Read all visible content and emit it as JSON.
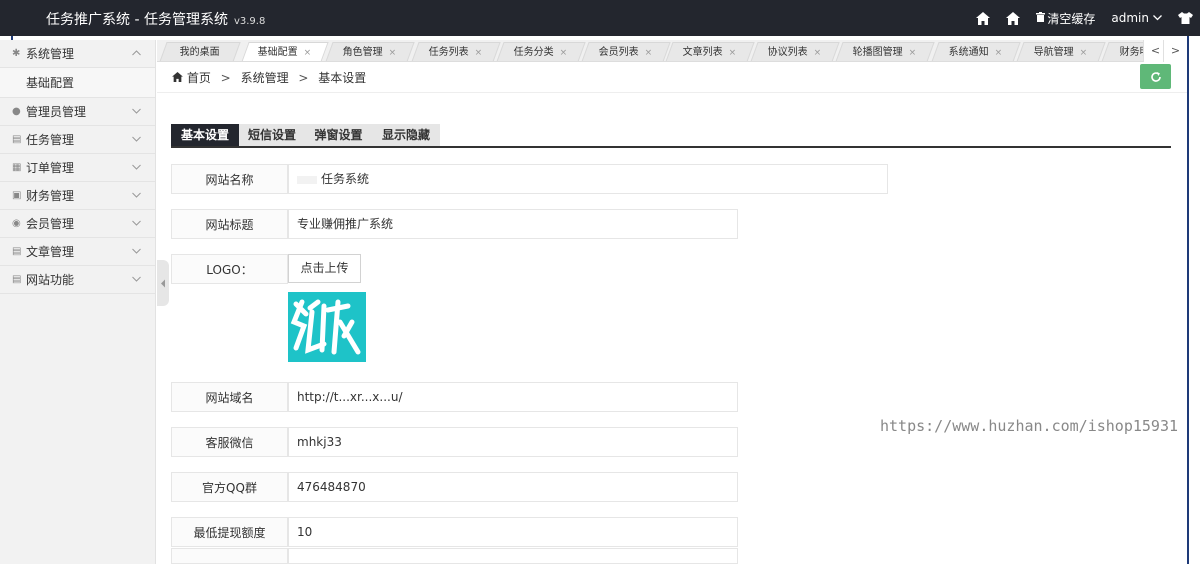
{
  "header": {
    "title": "任务推广系统 - 任务管理系统",
    "version": "v3.9.8",
    "home_icon_1": "home-icon",
    "home_icon_2": "home-icon",
    "clear_cache": "清空缓存",
    "user": "admin",
    "theme_icon": "shirt-icon"
  },
  "sidebar": {
    "items": [
      {
        "label": "系统管理",
        "icon": "gear-icon",
        "expanded": true
      },
      {
        "label": "管理员管理",
        "icon": "user-icon"
      },
      {
        "label": "任务管理",
        "icon": "list-icon"
      },
      {
        "label": "订单管理",
        "icon": "order-icon"
      },
      {
        "label": "财务管理",
        "icon": "finance-icon"
      },
      {
        "label": "会员管理",
        "icon": "member-icon"
      },
      {
        "label": "文章管理",
        "icon": "article-icon"
      },
      {
        "label": "网站功能",
        "icon": "site-icon"
      }
    ],
    "sub_item": "基础配置"
  },
  "tabs": [
    {
      "label": "我的桌面",
      "closable": false
    },
    {
      "label": "基础配置",
      "closable": true,
      "active": true
    },
    {
      "label": "角色管理",
      "closable": true
    },
    {
      "label": "任务列表",
      "closable": true
    },
    {
      "label": "任务分类",
      "closable": true
    },
    {
      "label": "会员列表",
      "closable": true
    },
    {
      "label": "文章列表",
      "closable": true
    },
    {
      "label": "协议列表",
      "closable": true
    },
    {
      "label": "轮播图管理",
      "closable": true
    },
    {
      "label": "系统通知",
      "closable": true
    },
    {
      "label": "导航管理",
      "closable": true
    },
    {
      "label": "财务明",
      "closable": false
    }
  ],
  "tab_close": "×",
  "tab_prev": "<",
  "tab_next": ">",
  "breadcrumb": {
    "home": "首页",
    "sep": ">",
    "level1": "系统管理",
    "level2": "基本设置"
  },
  "subtabs": [
    "基本设置",
    "短信设置",
    "弹窗设置",
    "显示隐藏"
  ],
  "form": {
    "site_name_label": "网站名称",
    "site_name_value": "任务系统",
    "site_title_label": "网站标题",
    "site_title_value": "专业赚佣推广系统",
    "logo_label": "LOGO：",
    "upload_button": "点击上传",
    "domain_label": "网站域名",
    "domain_value": "http://t...xr...x...u/",
    "wechat_label": "客服微信",
    "wechat_value": "mhkj33",
    "qq_label": "官方QQ群",
    "qq_value": "476484870",
    "min_withdraw_label": "最低提现额度",
    "min_withdraw_value": "10"
  },
  "watermark": "https://www.huzhan.com/ishop15931",
  "colors": {
    "topbar": "#23262e",
    "accent_green": "#5fb878",
    "logo_bg": "#1ec3c8"
  }
}
